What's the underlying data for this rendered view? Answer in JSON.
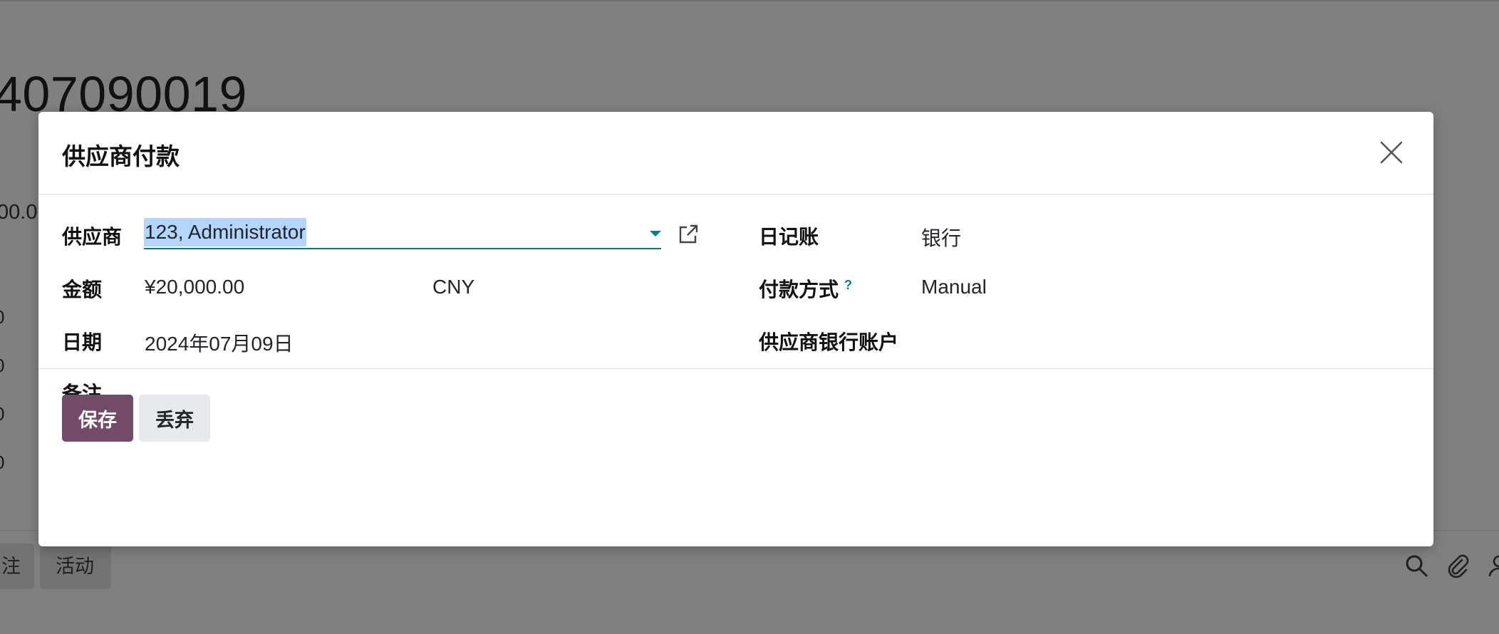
{
  "background": {
    "record_title": "407090019",
    "amount_fragment": "00.0",
    "digit_fragments": [
      "0",
      "0",
      "0",
      "0"
    ],
    "chatter_chips": [
      "注",
      "活动"
    ],
    "chatter_icons": [
      "search-icon",
      "paperclip-icon",
      "person-icon"
    ]
  },
  "dialog": {
    "title": "供应商付款",
    "close_icon": "close-icon",
    "fields": {
      "partner": {
        "label": "供应商",
        "value": "123, Administrator"
      },
      "amount": {
        "label": "金额",
        "value": "¥20,000.00",
        "currency": "CNY"
      },
      "date": {
        "label": "日期",
        "value": "2024年07月09日"
      },
      "memo": {
        "label": "备注",
        "value": ""
      },
      "journal": {
        "label": "日记账",
        "value": "银行"
      },
      "payment_method": {
        "label": "付款方式",
        "help": "?",
        "value": "Manual"
      },
      "partner_bank": {
        "label": "供应商银行账户",
        "value": ""
      }
    },
    "buttons": {
      "save": "保存",
      "discard": "丢弃"
    }
  },
  "colors": {
    "backdrop": "#808080",
    "primary": "#714b67",
    "accent": "#017e84",
    "selection": "#b4d5fe",
    "secondary_button": "#e7e9ed"
  }
}
